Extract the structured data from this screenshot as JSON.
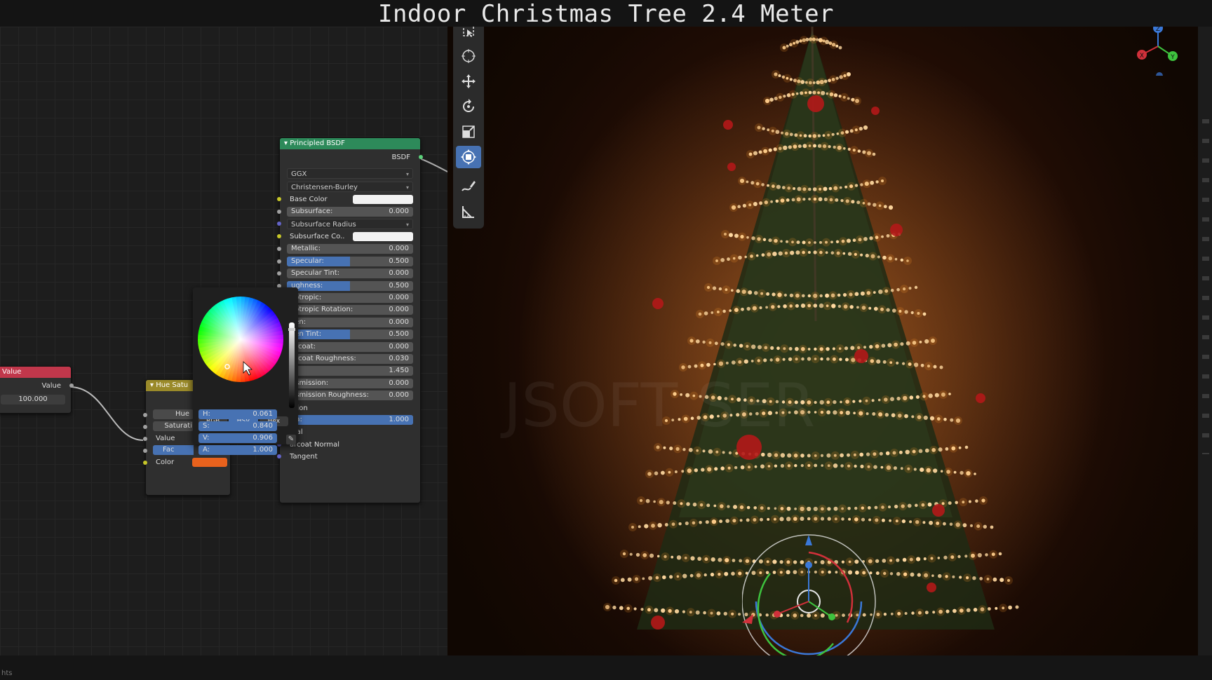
{
  "title": "Indoor Christmas Tree 2.4 Meter",
  "status_text": "hts",
  "watermark": "JSOFT SER",
  "colors": {
    "value_node_header": "#c1374b",
    "hue_node_header": "#9a8a2a",
    "bsdf_node_header": "#2d8a5a",
    "accent": "#4772b3",
    "color_swatch": "#e8621d"
  },
  "value_node": {
    "header": "Value",
    "output_label": "Value",
    "value": "100.000"
  },
  "hue_node": {
    "header": "Hue Satu",
    "inputs": [
      "Hue",
      "Saturati",
      "Value",
      "Fac",
      "Color"
    ]
  },
  "bsdf_node": {
    "header": "Principled BSDF",
    "output": "BSDF",
    "distribution": "GGX",
    "subsurface_method": "Christensen-Burley",
    "rows": [
      {
        "label": "Base Color",
        "type": "color"
      },
      {
        "label": "Subsurface:",
        "value": "0.000"
      },
      {
        "label": "Subsurface Radius",
        "type": "dropdown"
      },
      {
        "label": "Subsurface Co..",
        "type": "color"
      },
      {
        "label": "Metallic:",
        "value": "0.000"
      },
      {
        "label": "Specular:",
        "value": "0.500",
        "fill": 0.5
      },
      {
        "label": "Specular Tint:",
        "value": "0.000"
      },
      {
        "label": "ughness:",
        "value": "0.500",
        "fill": 0.5
      },
      {
        "label": "sotropic:",
        "value": "0.000"
      },
      {
        "label": "sotropic Rotation:",
        "value": "0.000"
      },
      {
        "label": "sen:",
        "value": "0.000"
      },
      {
        "label": "sen Tint:",
        "value": "0.500",
        "fill": 0.5
      },
      {
        "label": "arcoat:",
        "value": "0.000"
      },
      {
        "label": "arcoat Roughness:",
        "value": "0.030"
      },
      {
        "label": "R:",
        "value": "1.450"
      },
      {
        "label": "nsmission:",
        "value": "0.000"
      },
      {
        "label": "nsmission Roughness:",
        "value": "0.000"
      },
      {
        "label": "ssion",
        "type": "label"
      },
      {
        "label": "ha:",
        "value": "1.000",
        "fill": 1.0
      },
      {
        "label": "mal",
        "type": "label"
      },
      {
        "label": "arcoat Normal",
        "type": "label"
      },
      {
        "label": "Tangent",
        "type": "label"
      }
    ]
  },
  "color_picker": {
    "modes": [
      "RGB",
      "HSV",
      "Hex"
    ],
    "active_mode": "HSV",
    "fields": [
      {
        "label": "H:",
        "value": "0.061"
      },
      {
        "label": "S:",
        "value": "0.840"
      },
      {
        "label": "V:",
        "value": "0.906"
      },
      {
        "label": "A:",
        "value": "1.000"
      }
    ]
  },
  "toolbar": {
    "tools": [
      "select-box-icon",
      "cursor-icon",
      "move-icon",
      "rotate-icon",
      "scale-icon",
      "transform-icon",
      "annotate-icon",
      "measure-icon"
    ],
    "active_tool": "transform-icon"
  },
  "gizmo": {
    "axes": [
      "X",
      "Y",
      "Z"
    ]
  }
}
